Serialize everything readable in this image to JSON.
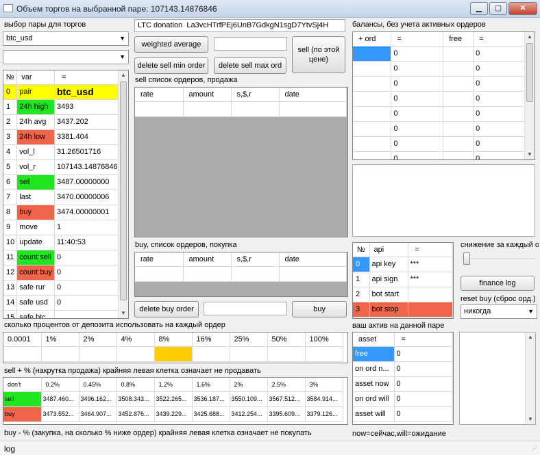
{
  "window": {
    "title": "Объем торгов на выбранной паре: 107143.14876846",
    "min": "▁",
    "max": "▢",
    "close": "✕"
  },
  "pair_select": {
    "label": "выбор пары для торгов",
    "value": "btc_usd",
    "second_value": ""
  },
  "main_grid": {
    "headers": [
      "№",
      "var",
      "="
    ],
    "rows": [
      {
        "n": "0",
        "var": "pair",
        "val": "btc_usd",
        "style": "yellow"
      },
      {
        "n": "1",
        "var": "24h high",
        "val": "3493",
        "style": "green"
      },
      {
        "n": "2",
        "var": "24h avg",
        "val": "3437.202",
        "style": ""
      },
      {
        "n": "3",
        "var": "24h low",
        "val": "3381.404",
        "style": "red"
      },
      {
        "n": "4",
        "var": "vol_l",
        "val": "31.26501716",
        "style": ""
      },
      {
        "n": "5",
        "var": "vol_r",
        "val": "107143.14876846",
        "style": ""
      },
      {
        "n": "6",
        "var": "sell",
        "val": "3487.00000000",
        "style": "green"
      },
      {
        "n": "7",
        "var": "last",
        "val": "3470.00000006",
        "style": ""
      },
      {
        "n": "8",
        "var": "buy",
        "val": "3474.00000001",
        "style": "red"
      },
      {
        "n": "9",
        "var": "move",
        "val": "1",
        "style": ""
      },
      {
        "n": "10",
        "var": "update",
        "val": "11:40:53",
        "style": ""
      },
      {
        "n": "11",
        "var": "count sell",
        "val": "0",
        "style": "green"
      },
      {
        "n": "12",
        "var": "count buy",
        "val": "0",
        "style": "red"
      },
      {
        "n": "13",
        "var": "safe rur",
        "val": "0",
        "style": ""
      },
      {
        "n": "14",
        "var": "safe usd",
        "val": "0",
        "style": ""
      },
      {
        "n": "15",
        "var": "safe btc",
        "val": "",
        "style": ""
      }
    ]
  },
  "donation": {
    "label": "LTC donation",
    "address": "La3vcHTrfPEj6UnB7GdkgN1sgD7YtvSj4H"
  },
  "buttons": {
    "weighted_average": "weighted average",
    "delete_sell_min": "delete sell min order",
    "delete_sell_max": "delete sell max ord",
    "sell_at_price": "sell (по этой цене)",
    "delete_buy_order": "delete buy order",
    "buy": "buy",
    "finance_log": "finance log"
  },
  "sell_orders": {
    "label": "sell список ордеров, продажа",
    "headers": [
      "rate",
      "amount",
      "s,$,r",
      "date"
    ]
  },
  "buy_orders": {
    "label": "buy, список ордеров, покупка",
    "headers": [
      "rate",
      "amount",
      "s,$,r",
      "date"
    ]
  },
  "balances": {
    "label": "балансы, без учета активных ордеров",
    "headers": [
      "+ ord",
      "=",
      "free",
      "="
    ],
    "rows": [
      [
        "",
        "0",
        "",
        "0"
      ],
      [
        "",
        "0",
        "",
        "0"
      ],
      [
        "",
        "0",
        "",
        "0"
      ],
      [
        "",
        "0",
        "",
        "0"
      ],
      [
        "",
        "0",
        "",
        "0"
      ],
      [
        "",
        "0",
        "",
        "0"
      ],
      [
        "",
        "0",
        "",
        "0"
      ],
      [
        "",
        "0",
        "",
        "0"
      ]
    ]
  },
  "api_grid": {
    "headers": [
      "№",
      "api",
      "="
    ],
    "rows": [
      {
        "n": "0",
        "api": "api key",
        "val": "***",
        "style": "blue"
      },
      {
        "n": "1",
        "api": "api sign",
        "val": "***",
        "style": ""
      },
      {
        "n": "2",
        "api": "bot start",
        "val": "",
        "style": ""
      },
      {
        "n": "3",
        "api": "bot stop",
        "val": "",
        "style": "red"
      }
    ]
  },
  "decrease": {
    "label": "снижение за каждый о"
  },
  "reset_buy": {
    "label": "reset buy (сброс орд.)",
    "value": "никогда"
  },
  "deposit_percent": {
    "label": "сколько процентов от депозита использовать на каждый ордер",
    "options": [
      "0.0001",
      "1%",
      "2%",
      "4%",
      "8%",
      "16%",
      "25%",
      "50%",
      "100%"
    ],
    "selected_index": 4
  },
  "sell_markup": {
    "label": "sell + % (накрутка продажа) крайняя левая клетка означает не продавать"
  },
  "pct_grid": {
    "headers": [
      "don't",
      "0.2%",
      "0.45%",
      "0.8%",
      "1.2%",
      "1.6%",
      "2%",
      "2.5%",
      "3%"
    ],
    "sell_row": [
      "sell",
      "3487.460...",
      "3496.162...",
      "3508.343...",
      "3522.265...",
      "3536.187...",
      "3550.109...",
      "3567.512...",
      "3584.914..."
    ],
    "buy_row": [
      "buy",
      "3473.552...",
      "3464.907...",
      "3452.876...",
      "3439.229...",
      "3425.688...",
      "3412.254...",
      "3395.609...",
      "3379.126..."
    ]
  },
  "buy_markdown": {
    "label": "buy - % (закупка, на сколько % ниже ордер) крайняя левая клетка означает не покупать"
  },
  "asset_grid": {
    "label": "ваш актив на данной паре",
    "headers": [
      "asset",
      "="
    ],
    "rows": [
      {
        "asset": "free",
        "val": "0",
        "style": "blue"
      },
      {
        "asset": "on ord n...",
        "val": "0",
        "style": ""
      },
      {
        "asset": "asset now",
        "val": "0",
        "style": ""
      },
      {
        "asset": "on ord will",
        "val": "0",
        "style": ""
      },
      {
        "asset": "asset will",
        "val": "0",
        "style": ""
      }
    ]
  },
  "legend_now_will": "now=сейчас,will=ожидание",
  "status": {
    "log": "log"
  }
}
